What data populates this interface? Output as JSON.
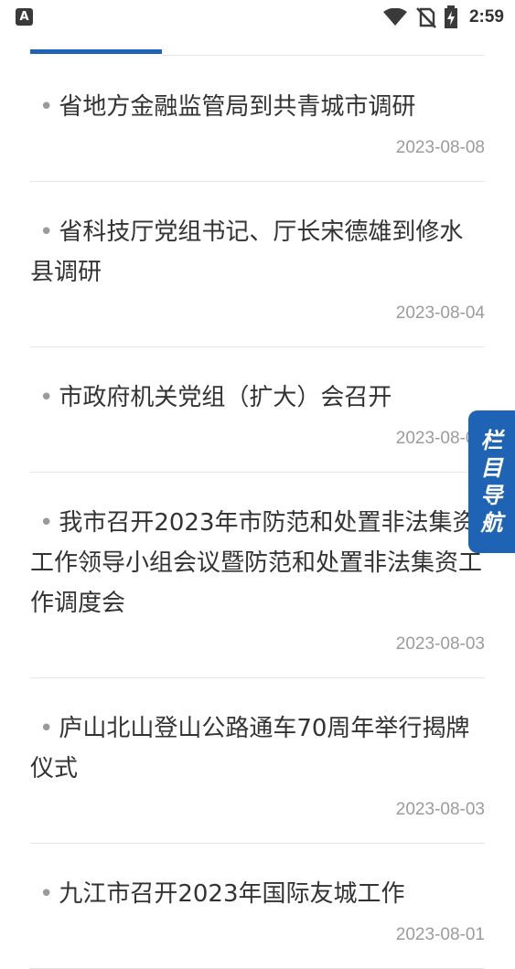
{
  "status_bar": {
    "app_icon_letter": "A",
    "time": "2:59",
    "icons": [
      "wifi-icon",
      "no-sim-icon",
      "battery-charging-icon"
    ]
  },
  "colors": {
    "accent": "#1f63b4",
    "title_text": "#333333",
    "date_text": "#9b9b9b",
    "divider": "#e6e6e6"
  },
  "news": [
    {
      "bullet": "•",
      "title": "省地方金融监管局到共青城市调研",
      "date": "2023-08-08"
    },
    {
      "bullet": "•",
      "title": "省科技厅党组书记、厅长宋德雄到修水县调研",
      "date": "2023-08-04"
    },
    {
      "bullet": "•",
      "title": "市政府机关党组（扩大）会召开",
      "date": "2023-08-03"
    },
    {
      "bullet": "•",
      "title": "我市召开2023年市防范和处置非法集资工作领导小组会议暨防范和处置非法集资工作调度会",
      "date": "2023-08-03"
    },
    {
      "bullet": "•",
      "title": "庐山北山登山公路通车70周年举行揭牌仪式",
      "date": "2023-08-03"
    },
    {
      "bullet": "•",
      "title": "九江市召开2023年国际友城工作",
      "date": "2023-08-01"
    }
  ],
  "nav_tab": {
    "chars": [
      "栏",
      "目",
      "导",
      "航"
    ]
  }
}
